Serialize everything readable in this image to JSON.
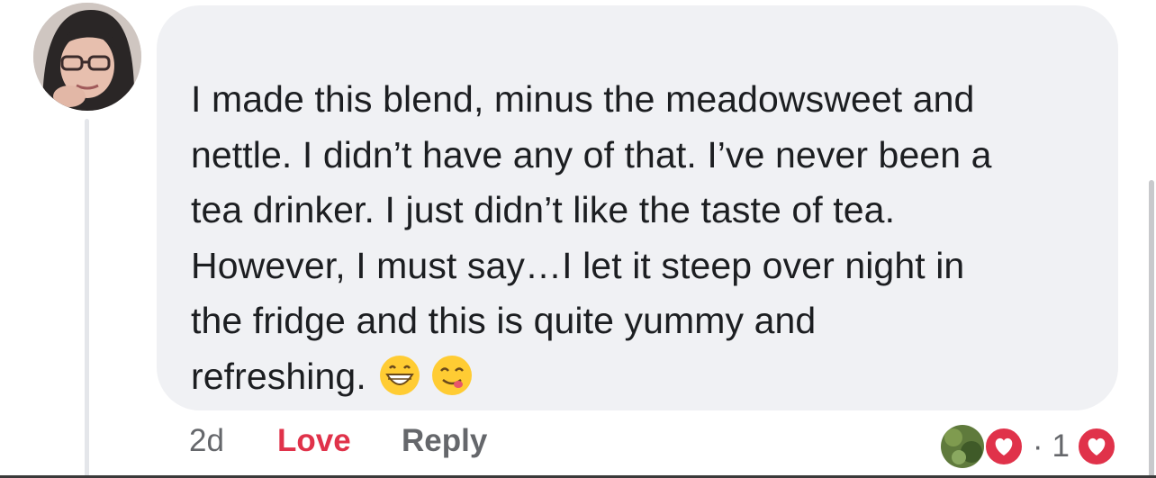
{
  "comment": {
    "text": "I made this blend, minus the meadowsweet and\nnettle. I didn’t have any of that. I’ve never been a\ntea drinker. I just didn’t like the taste of tea.\nHowever, I must say…I let it steep over night in\nthe fridge and this is quite yummy and\nrefreshing.",
    "emojis": [
      "grinning-face-emoji",
      "face-savoring-food-emoji"
    ]
  },
  "meta": {
    "timestamp": "2d",
    "reaction_label": "Love",
    "reply_label": "Reply"
  },
  "reactions": {
    "count": "1",
    "separator": "·",
    "type": "love",
    "accent_color": "#e0324a"
  },
  "colors": {
    "bubble": "#f0f1f4",
    "text": "#1c1e21",
    "secondary": "#65676b",
    "love": "#e0324a"
  }
}
